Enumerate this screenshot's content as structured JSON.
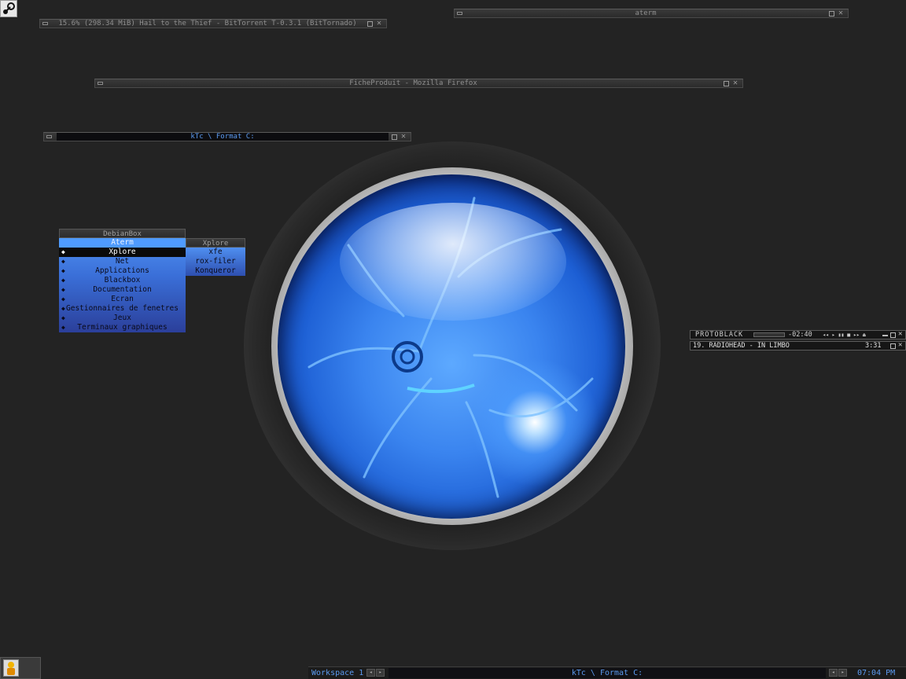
{
  "windows": {
    "bittorrent": {
      "title": "15.6% (298.34 MiB) Hail to the Thief - BitTorrent T-0.3.1 (BitTornado)"
    },
    "aterm": {
      "title": "aterm"
    },
    "firefox": {
      "title": "FicheProduit - Mozilla Firefox"
    },
    "ktc": {
      "title": "kTc \\ Format C:"
    }
  },
  "menu": {
    "title": "DebianBox",
    "items": [
      {
        "label": "Aterm",
        "bullet": ""
      },
      {
        "label": "Xplore",
        "bullet": "◆"
      },
      {
        "label": "Net",
        "bullet": "◆"
      },
      {
        "label": "Applications",
        "bullet": "◆"
      },
      {
        "label": "Blackbox",
        "bullet": "◆"
      },
      {
        "label": "Documentation",
        "bullet": "◆"
      },
      {
        "label": "Ecran",
        "bullet": "◆"
      },
      {
        "label": "Gestionnaires de fenetres",
        "bullet": "◆"
      },
      {
        "label": "Jeux",
        "bullet": "◆"
      },
      {
        "label": "Terminaux graphiques",
        "bullet": "◆"
      }
    ]
  },
  "submenu": {
    "title": "Xplore",
    "items": [
      {
        "label": "xfe"
      },
      {
        "label": "rox-filer"
      },
      {
        "label": "Konqueror"
      }
    ]
  },
  "player": {
    "name": "PROTOBLACK",
    "time": "-02:40",
    "track": "19. RADIOHEAD - IN LIMBO",
    "duration": "3:31",
    "controls": "◂◂ ▸ ▮▮ ■ ▸▸ ⏏"
  },
  "taskbar": {
    "workspace": "Workspace 1",
    "window": "kTc \\ Format C:",
    "clock": "07:04 PM"
  },
  "colors": {
    "accent": "#5b9af0",
    "background": "#232323",
    "menu_blue": "#3a6fd8"
  }
}
